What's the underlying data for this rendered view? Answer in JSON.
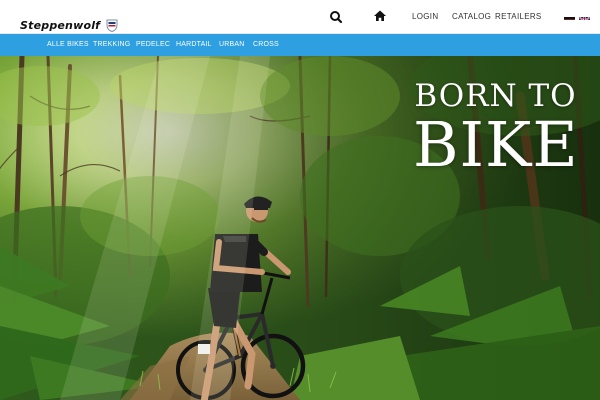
{
  "header": {
    "logo_text": "Steppenwolf",
    "nav": {
      "login": "LOGIN",
      "catalog": "CATALOG",
      "retailers": "RETAILERS"
    },
    "icons": {
      "search": "search-icon",
      "home": "home-icon",
      "logo_badge": "shield-icon"
    },
    "languages": [
      "de",
      "en"
    ]
  },
  "categories": [
    "ALLE BIKES",
    "TREKKING",
    "PEDELEC",
    "HARDTAIL",
    "URBAN",
    "CROSS"
  ],
  "hero": {
    "headline_line1": "BORN TO",
    "headline_line2": "BIKE"
  },
  "colors": {
    "accent": "#2e9fe0",
    "header_bg": "#ffffff",
    "text_dark": "#333333"
  }
}
